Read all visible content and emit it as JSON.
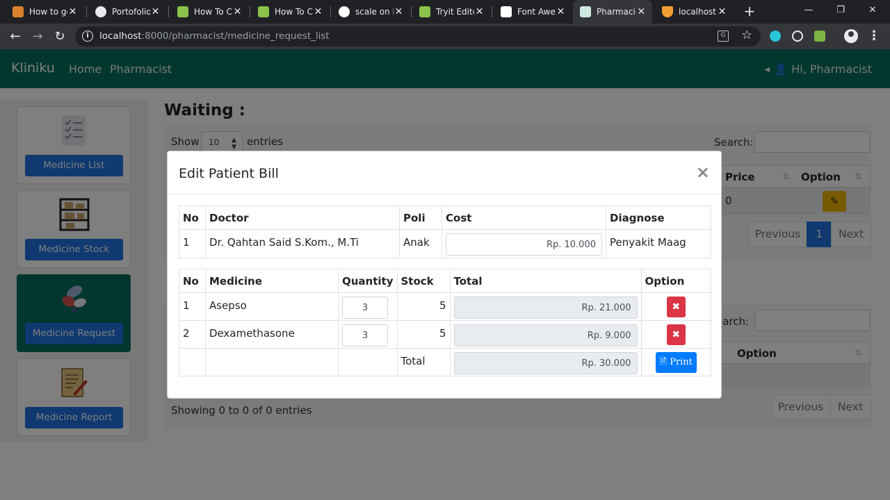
{
  "browser": {
    "tabs": [
      {
        "title": "How to ge",
        "favicon_color": "#d9822b"
      },
      {
        "title": "Portofolio",
        "favicon_color": "#e8eaed"
      },
      {
        "title": "How To C",
        "favicon_color": "#8bc34a"
      },
      {
        "title": "How To C",
        "favicon_color": "#8bc34a"
      },
      {
        "title": "scale on h",
        "favicon_color": "#ffffff"
      },
      {
        "title": "Tryit Edito",
        "favicon_color": "#8bc34a"
      },
      {
        "title": "Font Awe",
        "favicon_color": "#ffffff"
      },
      {
        "title": "Pharmaci",
        "favicon_color": "#cfe8e2"
      },
      {
        "title": "localhost",
        "favicon_color": "#f0a030"
      }
    ],
    "active_tab_index": 7,
    "url_host": "localhost",
    "url_rest": ":8000/pharmacist/medicine_request_list",
    "new_tab_symbol": "+",
    "window_controls": [
      "—",
      "❐",
      "✕"
    ]
  },
  "app": {
    "brand": "Kliniku",
    "nav": [
      "Home",
      "Pharmacist"
    ],
    "greeting": "Hi, Pharmacist",
    "accent": "#036f5c"
  },
  "sidebar": {
    "items": [
      {
        "label": "Medicine List",
        "icon": "checklist-icon"
      },
      {
        "label": "Medicine Stock",
        "icon": "shelf-icon"
      },
      {
        "label": "Medicine Request",
        "icon": "pills-icon"
      },
      {
        "label": "Medicine Report",
        "icon": "report-icon"
      }
    ],
    "active_index": 2
  },
  "main": {
    "title": "Waiting :",
    "show_label": "Show",
    "entries_value": "10",
    "entries_label": "entries",
    "search_label": "Search:",
    "search_label_2": "earch:",
    "headers_top": [
      "Price",
      "Option"
    ],
    "headers_bottom": [
      "Option"
    ],
    "partial_cell": "0",
    "pagination_prev": "Previous",
    "pagination_page": "1",
    "pagination_next": "Next",
    "showing": "Showing 0 to 0 of 0 entries"
  },
  "modal": {
    "title": "Edit Patient Bill",
    "close": "×",
    "doctor_table": {
      "headers": [
        "No",
        "Doctor",
        "Poli",
        "Cost",
        "Diagnose"
      ],
      "row": {
        "no": "1",
        "doctor": "Dr. Qahtan Said S.Kom., M.Ti",
        "poli": "Anak",
        "cost": "Rp. 10.000",
        "diagnose": "Penyakit Maag"
      }
    },
    "medicine_table": {
      "headers": [
        "No",
        "Medicine",
        "Quantity",
        "Stock",
        "Total",
        "Option"
      ],
      "rows": [
        {
          "no": "1",
          "medicine": "Asepso",
          "quantity": "3",
          "stock": "5",
          "total": "Rp. 21.000"
        },
        {
          "no": "2",
          "medicine": "Dexamethasone",
          "quantity": "3",
          "stock": "5",
          "total": "Rp. 9.000"
        }
      ],
      "total_label": "Total",
      "grand_total": "Rp. 30.000",
      "print_label": "Print",
      "delete_symbol": "✖"
    }
  }
}
